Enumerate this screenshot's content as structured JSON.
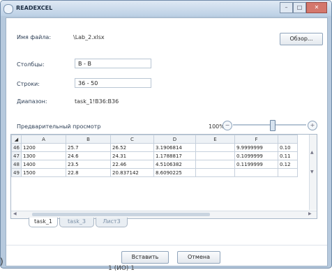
{
  "window": {
    "title": "READEXCEL",
    "controls": {
      "minimize": "–",
      "maximize": "□",
      "close": "✕"
    }
  },
  "form": {
    "file_label": "Имя файла:",
    "file_value": "\\Lab_2.xlsx",
    "browse_label": "Обзор...",
    "columns_label": "Столбцы:",
    "columns_value": "B - B",
    "rows_label": "Строки:",
    "rows_value": "36 - 50",
    "range_label": "Диапазон:",
    "range_value": "task_1!B36:B36"
  },
  "preview": {
    "label": "Предварительный просмотр",
    "zoom_percent": "100%",
    "zoom_out_icon": "minus-icon",
    "zoom_in_icon": "plus-icon",
    "columns": [
      "A",
      "B",
      "C",
      "D",
      "E",
      "F"
    ],
    "rows": [
      {
        "num": "46",
        "cells": [
          "1200",
          "25.7",
          "26.52",
          "3.1906814",
          "",
          "9.9999999",
          "0.10"
        ]
      },
      {
        "num": "47",
        "cells": [
          "1300",
          "24.6",
          "24.31",
          "1.1788817",
          "",
          "0.1099999",
          "0.11"
        ]
      },
      {
        "num": "48",
        "cells": [
          "1400",
          "23.5",
          "22.46",
          "4.5106382",
          "",
          "0.1199999",
          "0.12"
        ]
      },
      {
        "num": "49",
        "cells": [
          "1500",
          "22.8",
          "20.837142",
          "8.6090225",
          "",
          "",
          ""
        ]
      }
    ]
  },
  "sheets": [
    "task_1",
    "task_3",
    "Лист3"
  ],
  "buttons": {
    "insert": "Вставить",
    "cancel": "Отмена"
  },
  "outside": {
    "paren": ")",
    "caption": "1 (ИО) 1"
  }
}
